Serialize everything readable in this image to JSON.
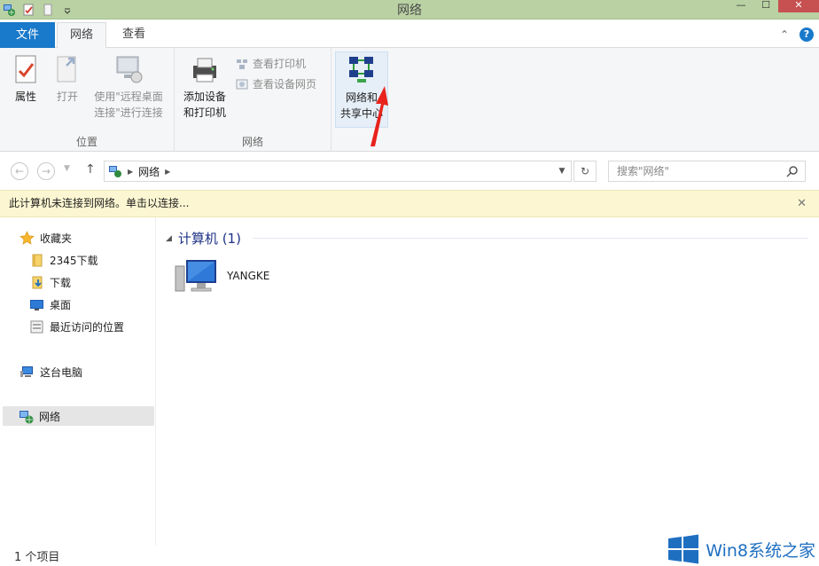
{
  "window": {
    "title": "网络",
    "minimize": "—",
    "maximize": "☐",
    "close": "✕"
  },
  "ribbon_tabs": {
    "file": "文件",
    "network": "网络",
    "view": "查看"
  },
  "ribbon": {
    "location_group": {
      "label": "位置",
      "properties": "属性",
      "open": "打开",
      "remote_line1": "使用\"远程桌面",
      "remote_line2": "连接\"进行连接"
    },
    "network_group": {
      "label": "网络",
      "add_devices_line1": "添加设备",
      "add_devices_line2": "和打印机",
      "view_printers": "查看打印机",
      "view_device_webpage": "查看设备网页"
    },
    "sharing_center_line1": "网络和",
    "sharing_center_line2": "共享中心"
  },
  "address": {
    "location": "网络",
    "search_placeholder": "搜索\"网络\""
  },
  "infobar": {
    "message": "此计算机未连接到网络。单击以连接..."
  },
  "sidebar": {
    "favorites": "收藏夹",
    "items": [
      "2345下载",
      "下载",
      "桌面",
      "最近访问的位置"
    ],
    "this_pc": "这台电脑",
    "network": "网络"
  },
  "content": {
    "group_title": "计算机 (1)",
    "computers": [
      "YANGKE"
    ]
  },
  "status": {
    "count": "1 个项目"
  },
  "watermark": {
    "text": "Win8系统之家"
  },
  "colors": {
    "titlebar": "#b9d1a3",
    "file_tab": "#1979ca",
    "infobar": "#fcf7d2",
    "accent": "#1e3287",
    "arrow": "#e8221c"
  }
}
